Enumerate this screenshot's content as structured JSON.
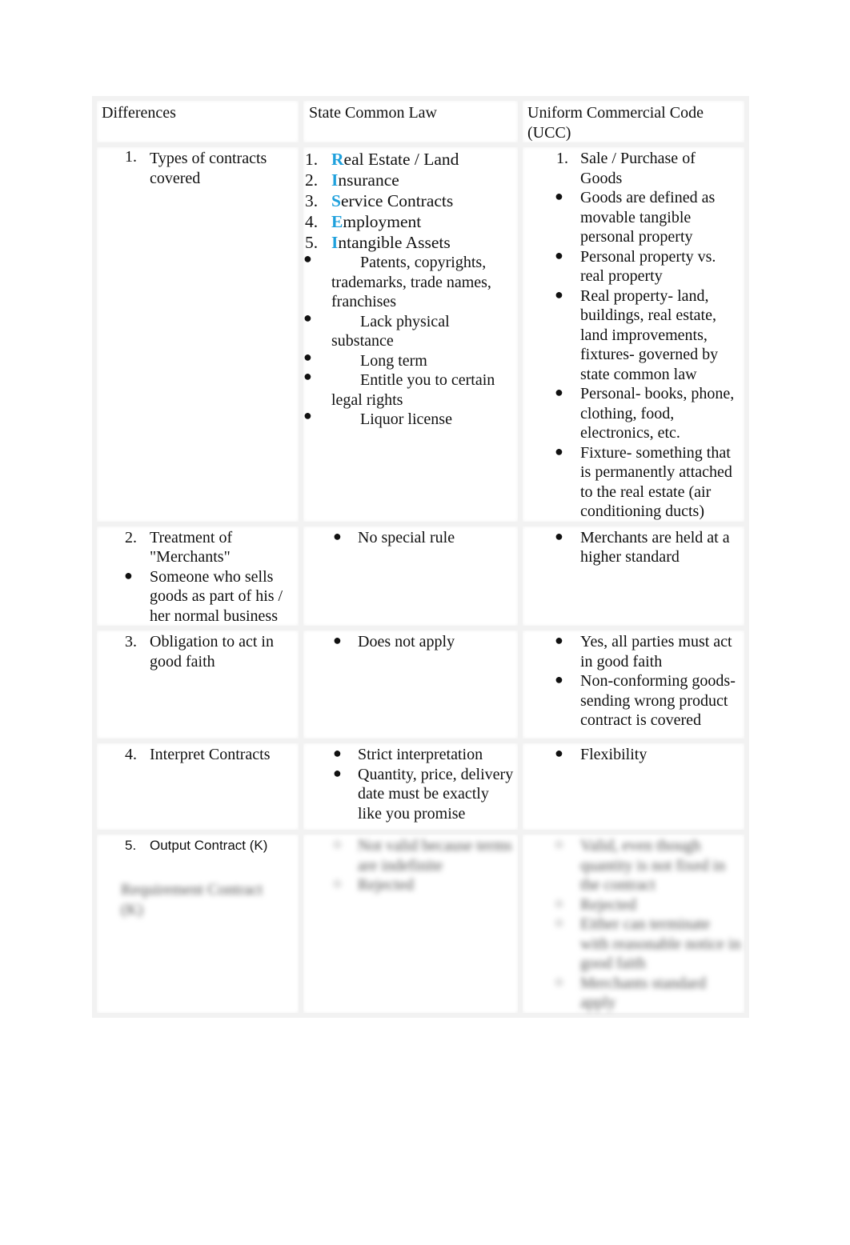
{
  "table": {
    "headers": [
      "Differences",
      "State Common Law",
      "Uniform Commercial Code (UCC)"
    ],
    "accent_color": "#1ea0dc",
    "rows": [
      {
        "difference": {
          "number": "1.",
          "text": "Types of contracts covered"
        },
        "common_law": {
          "numbered": [
            {
              "number": "1.",
              "initial": "R",
              "rest": "eal Estate / Land"
            },
            {
              "number": "2.",
              "initial": "I",
              "rest": "nsurance"
            },
            {
              "number": "3.",
              "initial": "S",
              "rest": "ervice Contracts"
            },
            {
              "number": "4.",
              "initial": "E",
              "rest": "mployment"
            },
            {
              "number": "5.",
              "initial": "I",
              "rest": "ntangible Assets"
            }
          ],
          "bullets": [
            "Patents, copyrights, trademarks, trade names, franchises",
            "Lack physical substance",
            "Long term",
            "Entitle you to certain legal rights",
            "Liquor license"
          ]
        },
        "ucc": {
          "numbered": {
            "number": "1.",
            "text": "Sale / Purchase of Goods"
          },
          "bullets": [
            "Goods are defined as movable tangible personal property",
            "Personal property vs. real property",
            "Real property- land, buildings, real estate, land improvements, fixtures- governed by state common law",
            "Personal- books, phone, clothing, food, electronics, etc.",
            "Fixture- something that is permanently attached to the real estate (air conditioning ducts)"
          ]
        }
      },
      {
        "difference": {
          "number": "2.",
          "text": "Treatment of \"Merchants\"",
          "bullet": "Someone who sells goods as part of his / her normal business"
        },
        "common_law": {
          "bullets": [
            "No special rule"
          ]
        },
        "ucc": {
          "bullets": [
            "Merchants are held at a higher standard"
          ]
        }
      },
      {
        "difference": {
          "number": "3.",
          "text": "Obligation to act in good faith"
        },
        "common_law": {
          "bullets": [
            "Does not apply"
          ]
        },
        "ucc": {
          "bullets": [
            "Yes, all parties must act in good faith",
            "Non-conforming goods- sending wrong product contract is covered"
          ]
        }
      },
      {
        "difference": {
          "number": "4.",
          "text": "Interpret Contracts"
        },
        "common_law": {
          "bullets": [
            "Strict interpretation",
            "Quantity, price, delivery date must be exactly like you promise"
          ]
        },
        "ucc": {
          "bullets": [
            "Flexibility"
          ]
        }
      },
      {
        "difference": {
          "number": "5.",
          "text": "Output Contract (K)",
          "obscured_text": "Requirement Contract (K)"
        },
        "common_law": {
          "obscured": true,
          "bullets": [
            "Not valid because terms are indefinite",
            "Rejected"
          ]
        },
        "ucc": {
          "obscured": true,
          "bullets": [
            "Valid, even though quantity is not fixed in the contract",
            "Rejected",
            "Either can terminate with reasonable notice in good faith",
            "Merchants standard apply"
          ]
        }
      }
    ]
  }
}
